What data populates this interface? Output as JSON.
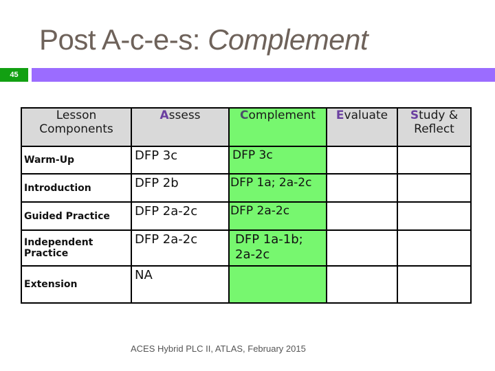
{
  "slide": {
    "title_prefix": "Post A-c-e-s: ",
    "title_emphasis": "Complement",
    "number": "45",
    "footer": "ACES Hybrid PLC II, ATLAS, February 2015"
  },
  "colors": {
    "title": "#6e625a",
    "slide_number_bg": "#12a012",
    "band": "#9b6cff",
    "header_bg": "#d9d9d9",
    "highlight_column": "#77f76f",
    "letter_accent": "#6a3fa0"
  },
  "table": {
    "headers": [
      {
        "label": "Lesson Components"
      },
      {
        "first": "A",
        "rest": "ssess"
      },
      {
        "first": "C",
        "rest": "omplement"
      },
      {
        "first": "E",
        "rest": "valuate"
      },
      {
        "first": "S",
        "rest": "tudy & Reflect"
      }
    ],
    "rows": [
      {
        "component": "Warm-Up",
        "assess": "DFP 3c",
        "complement": "DFP 3c",
        "evaluate": "",
        "study": ""
      },
      {
        "component": "Introduction",
        "assess": "DFP 2b",
        "complement": "DFP 1a; 2a-2c",
        "evaluate": "",
        "study": ""
      },
      {
        "component": "Guided Practice",
        "assess": "DFP 2a-2c",
        "complement": "DFP 2a-2c",
        "evaluate": "",
        "study": ""
      },
      {
        "component": "Independent Practice",
        "assess": "DFP 2a-2c",
        "complement": "DFP 1a-1b; 2a-2c",
        "evaluate": "",
        "study": ""
      },
      {
        "component": "Extension",
        "assess": "NA",
        "complement": "",
        "evaluate": "",
        "study": ""
      }
    ]
  }
}
